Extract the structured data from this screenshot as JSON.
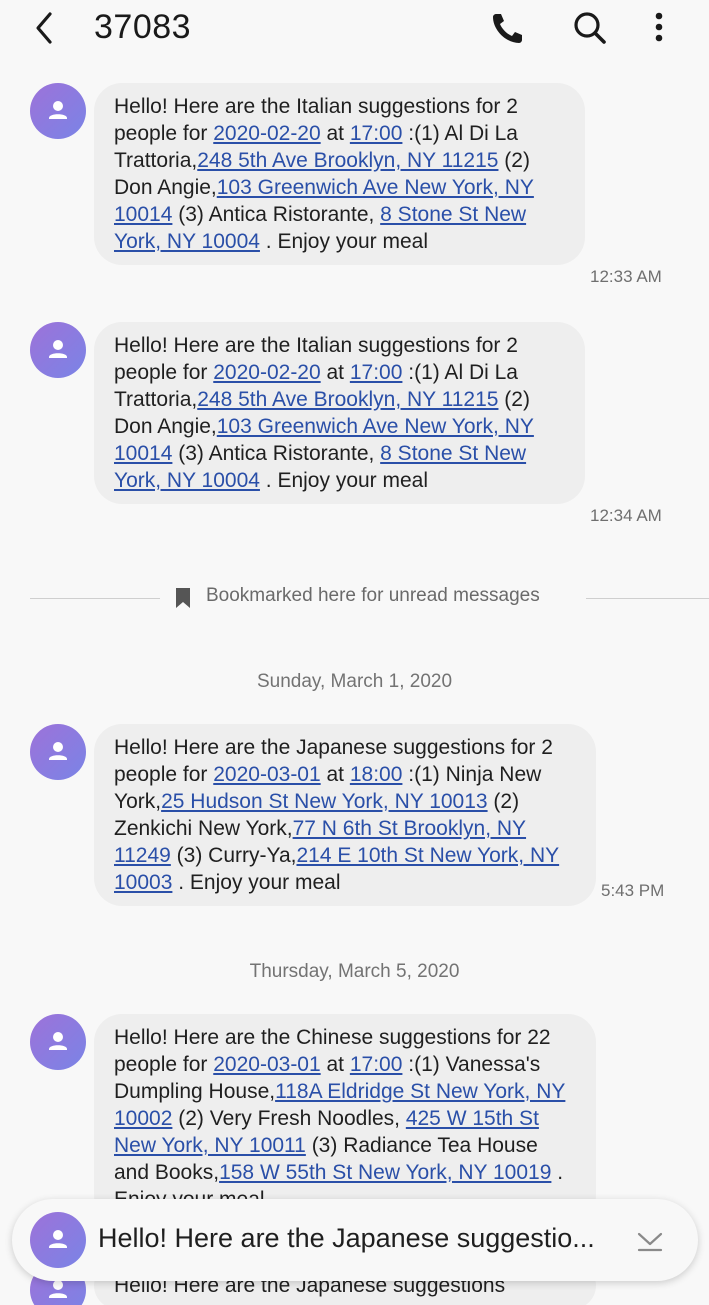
{
  "header": {
    "title": "37083",
    "icons": [
      "back-arrow-icon",
      "phone-icon",
      "search-icon",
      "more-vert-icon"
    ]
  },
  "messages": [
    {
      "segments": [
        {
          "t": "Hello! Here are the Italian suggestions for 2 people for "
        },
        {
          "t": "2020-02-20",
          "link": true
        },
        {
          "t": " at "
        },
        {
          "t": "17:00",
          "link": true
        },
        {
          "t": " :(1) Al Di La Trattoria,"
        },
        {
          "t": "248 5th Ave Brooklyn, NY 11215",
          "link": true
        },
        {
          "t": " (2) Don Angie,"
        },
        {
          "t": "103 Greenwich Ave New York, NY 10014",
          "link": true
        },
        {
          "t": " (3) Antica Ristorante, "
        },
        {
          "t": "8 Stone St New York, NY 10004",
          "link": true
        },
        {
          "t": " . Enjoy your meal"
        }
      ],
      "time": "12:33 AM"
    },
    {
      "segments": [
        {
          "t": "Hello! Here are the Italian suggestions for 2 people for "
        },
        {
          "t": "2020-02-20",
          "link": true
        },
        {
          "t": " at "
        },
        {
          "t": "17:00",
          "link": true
        },
        {
          "t": " :(1) Al Di La Trattoria,"
        },
        {
          "t": "248 5th Ave Brooklyn, NY 11215",
          "link": true
        },
        {
          "t": " (2) Don Angie,"
        },
        {
          "t": "103 Greenwich Ave New York, NY 10014",
          "link": true
        },
        {
          "t": " (3) Antica Ristorante, "
        },
        {
          "t": "8 Stone St New York, NY 10004",
          "link": true
        },
        {
          "t": " . Enjoy your meal"
        }
      ],
      "time": "12:34 AM"
    },
    {
      "segments": [
        {
          "t": "Hello! Here are the Japanese suggestions for 2 people for "
        },
        {
          "t": "2020-03-01",
          "link": true
        },
        {
          "t": " at "
        },
        {
          "t": "18:00",
          "link": true
        },
        {
          "t": " :(1) Ninja New York,"
        },
        {
          "t": "25 Hudson St New York, NY 10013",
          "link": true
        },
        {
          "t": " (2) Zenkichi New York,"
        },
        {
          "t": "77 N 6th St Brooklyn, NY 11249",
          "link": true
        },
        {
          "t": " (3) Curry-Ya,"
        },
        {
          "t": "214 E 10th St New York, NY 10003",
          "link": true
        },
        {
          "t": " . Enjoy your meal"
        }
      ],
      "time": "5:43 PM"
    },
    {
      "segments": [
        {
          "t": "Hello! Here are the Chinese suggestions for 22 people for "
        },
        {
          "t": "2020-03-01",
          "link": true
        },
        {
          "t": " at "
        },
        {
          "t": "17:00",
          "link": true
        },
        {
          "t": " :(1) Vanessa's Dumpling House,"
        },
        {
          "t": "118A Eldridge St New York, NY 10002",
          "link": true
        },
        {
          "t": " (2) Very Fresh Noodles, "
        },
        {
          "t": "425 W 15th St New York, NY 10011",
          "link": true
        },
        {
          "t": " (3) Radiance Tea House and Books,"
        },
        {
          "t": "158 W 55th St New York, NY 10019",
          "link": true
        },
        {
          "t": " . Enjoy your meal"
        }
      ],
      "time": ""
    },
    {
      "segments": [
        {
          "t": "Hello! Here are the Japanese suggestions"
        }
      ],
      "time": ""
    }
  ],
  "bookmark": {
    "label": "Bookmarked here for unread messages",
    "icon": "bookmark-icon"
  },
  "date_separators": [
    "Sunday, March 1, 2020",
    "Thursday, March 5, 2020"
  ],
  "preview": {
    "text": "Hello! Here are the Japanese suggestio...",
    "icon": "chevron-down-icon"
  },
  "colors": {
    "background": "#f8f8f8",
    "bubble": "#eeeeee",
    "link": "#2a4fa8",
    "avatar_start": "#9d72d9",
    "avatar_end": "#7a84e6"
  }
}
